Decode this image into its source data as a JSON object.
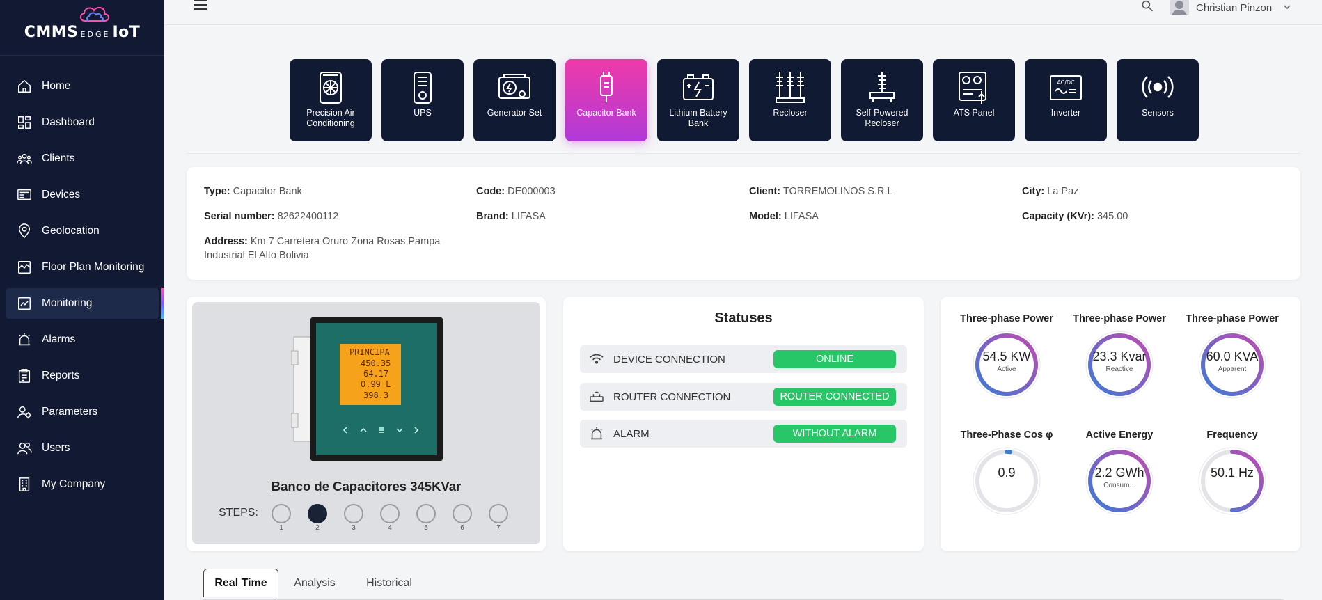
{
  "brand": {
    "left": "CMMS",
    "mid": "EDGE",
    "right": "IoT"
  },
  "sidebar": {
    "items": [
      {
        "label": "Home",
        "icon": "home-icon"
      },
      {
        "label": "Dashboard",
        "icon": "dashboard-icon"
      },
      {
        "label": "Clients",
        "icon": "clients-icon"
      },
      {
        "label": "Devices",
        "icon": "devices-icon"
      },
      {
        "label": "Geolocation",
        "icon": "location-pin-icon"
      },
      {
        "label": "Floor Plan Monitoring",
        "icon": "floor-plan-icon"
      },
      {
        "label": "Monitoring",
        "icon": "monitoring-icon",
        "active": true
      },
      {
        "label": "Alarms",
        "icon": "alarm-icon"
      },
      {
        "label": "Reports",
        "icon": "reports-icon"
      },
      {
        "label": "Parameters",
        "icon": "parameters-icon"
      },
      {
        "label": "Users",
        "icon": "users-icon"
      },
      {
        "label": "My Company",
        "icon": "company-icon"
      }
    ]
  },
  "topbar": {
    "user_name": "Christian Pinzon"
  },
  "equipment_tiles": [
    {
      "label": "Precision Air Conditioning"
    },
    {
      "label": "UPS"
    },
    {
      "label": "Generator Set"
    },
    {
      "label": "Capacitor Bank",
      "active": true
    },
    {
      "label": "Lithium Battery Bank"
    },
    {
      "label": "Recloser"
    },
    {
      "label": "Self-Powered Recloser"
    },
    {
      "label": "ATS Panel"
    },
    {
      "label": "Inverter"
    },
    {
      "label": "Sensors"
    }
  ],
  "info": {
    "type": {
      "label": "Type:",
      "value": "Capacitor Bank"
    },
    "code": {
      "label": "Code:",
      "value": "DE000003"
    },
    "client": {
      "label": "Client:",
      "value": "TORREMOLINOS S.R.L"
    },
    "city": {
      "label": "City:",
      "value": "La Paz"
    },
    "serial": {
      "label": "Serial number:",
      "value": "82622400112"
    },
    "brand": {
      "label": "Brand:",
      "value": "LIFASA"
    },
    "model": {
      "label": "Model:",
      "value": "LIFASA"
    },
    "capacity": {
      "label": "Capacity (KVr):",
      "value": "345.00"
    },
    "address": {
      "label": "Address:",
      "value": "Km 7 Carretera Oruro Zona Rosas Pampa Industrial El Alto Bolivia"
    }
  },
  "device": {
    "title": "Banco de Capacitores 345KVar",
    "steps_label": "STEPS:",
    "steps": [
      "1",
      "2",
      "3",
      "4",
      "5",
      "6",
      "7"
    ],
    "active_step": "2",
    "screen_lines": [
      "PRINCIPA",
      "450.35",
      "64.17",
      "0.99 L",
      "398.3"
    ]
  },
  "statuses": {
    "title": "Statuses",
    "rows": [
      {
        "label": "DEVICE CONNECTION",
        "badge": "ONLINE",
        "icon": "wifi-icon"
      },
      {
        "label": "ROUTER CONNECTION",
        "badge": "ROUTER CONNECTED",
        "icon": "router-icon"
      },
      {
        "label": "ALARM",
        "badge": "WITHOUT ALARM",
        "icon": "alarm-bell-icon"
      }
    ]
  },
  "gauges": [
    {
      "title": "Three-phase Power",
      "value": "54.5 KW",
      "sub": "Active",
      "fill": 1.0,
      "gradient": true
    },
    {
      "title": "Three-phase Power",
      "value": "23.3 Kvar",
      "sub": "Reactive",
      "fill": 1.0,
      "gradient": true
    },
    {
      "title": "Three-phase Power",
      "value": "60.0 KVA",
      "sub": "Apparent",
      "fill": 1.0,
      "gradient": true
    },
    {
      "title": "Three-Phase Cos φ",
      "value": "0.9",
      "sub": "",
      "fill": 0.02,
      "gradient": false
    },
    {
      "title": "Active Energy",
      "value": "2.2 GWh",
      "sub": "Consum...",
      "fill": 1.0,
      "gradient": true
    },
    {
      "title": "Frequency",
      "value": "50.1 Hz",
      "sub": "",
      "fill": 0.5,
      "gradient": true
    }
  ],
  "tabs": [
    "Real Time",
    "Analysis",
    "Historical"
  ],
  "active_tab": "Real Time",
  "colors": {
    "sidebar_bg": "#121a33",
    "tile_bg": "#111a33",
    "tile_active": "#e43aab",
    "badge_green": "#27c768",
    "gauge_blue": "#3a7bd5",
    "gauge_pink": "#c04bb0"
  }
}
